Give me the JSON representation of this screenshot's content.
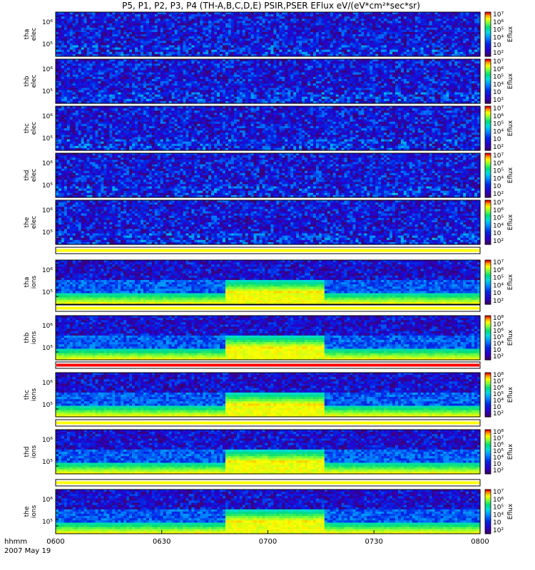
{
  "title": "P5, P1, P2, P3, P4 (TH-A,B,C,D,E) PSIR,PSER EFlux eV/(eV*cm²*sec*sr)",
  "footer": {
    "time_label": "hhmm",
    "date_label": "2007 May 19",
    "ticks": [
      "0600",
      "0630",
      "0700",
      "0730",
      "0800"
    ]
  },
  "colorbar_label": "Eflux",
  "chart_data": [
    {
      "type": "heatmap",
      "probe": "tha",
      "species": "elec",
      "ylabel_top": "tha",
      "ylabel_bottom": "elec",
      "y_scale": "log",
      "y_ticks": [
        "10⁶",
        "10⁵"
      ],
      "colorbar": [
        "10⁷",
        "10⁶",
        "10⁵",
        "10⁴",
        "10⁳",
        "10²"
      ],
      "values": "noisy background, mostly 10²–10³ throughout",
      "strip_color": ""
    },
    {
      "type": "heatmap",
      "probe": "thb",
      "species": "elec",
      "ylabel_top": "thb",
      "ylabel_bottom": "elec",
      "y_scale": "log",
      "y_ticks": [
        "10⁶",
        "10⁵"
      ],
      "colorbar": [
        "10⁷",
        "10⁶",
        "10⁵",
        "10⁴",
        "10⁳",
        "10²"
      ],
      "values": "noisy background, mostly 10²–10³ throughout",
      "strip_color": ""
    },
    {
      "type": "heatmap",
      "probe": "thc",
      "species": "elec",
      "ylabel_top": "thc",
      "ylabel_bottom": "elec",
      "y_scale": "log",
      "y_ticks": [
        "10⁶",
        "10⁵"
      ],
      "colorbar": [
        "10⁷",
        "10⁶",
        "10⁵",
        "10⁴",
        "10⁳",
        "10²"
      ],
      "values": "noisy background, mostly 10²–10³ throughout",
      "strip_color": ""
    },
    {
      "type": "heatmap",
      "probe": "thd",
      "species": "elec",
      "ylabel_top": "thd",
      "ylabel_bottom": "elec",
      "y_scale": "log",
      "y_ticks": [
        "10⁶",
        "10⁵"
      ],
      "colorbar": [
        "10⁷",
        "10⁶",
        "10⁵",
        "10⁴",
        "10⁳",
        "10²"
      ],
      "values": "noisy background, mostly 10²–10³ throughout",
      "strip_color": ""
    },
    {
      "type": "heatmap",
      "probe": "the",
      "species": "elec",
      "ylabel_top": "the",
      "ylabel_bottom": "elec",
      "y_scale": "log",
      "y_ticks": [
        "10⁶",
        "10⁵"
      ],
      "colorbar": [
        "10⁷",
        "10⁶",
        "10⁵",
        "10⁴",
        "10⁳",
        "10²"
      ],
      "values": "noisy background, mostly 10²–10³ throughout",
      "strip_color": "#ffff00"
    },
    {
      "type": "heatmap",
      "probe": "tha",
      "species": "ions",
      "ylabel_top": "tha",
      "ylabel_bottom": "ions",
      "y_scale": "log",
      "y_ticks": [
        "10⁶",
        "10⁵"
      ],
      "colorbar": [
        "10⁷",
        "10⁶",
        "10⁵",
        "10⁴",
        "10⁳",
        "10²"
      ],
      "values": "low-energy band ~10⁴ throughout; intense band ~10⁶ from 0648 to 0716",
      "strip_color": "#ffff00"
    },
    {
      "type": "heatmap",
      "probe": "thb",
      "species": "ions",
      "ylabel_top": "thb",
      "ylabel_bottom": "ions",
      "y_scale": "log",
      "y_ticks": [
        "10⁶",
        "10⁵"
      ],
      "colorbar": [
        "10⁸",
        "10⁷",
        "10⁶",
        "10⁵",
        "10⁴",
        "10⁳",
        "10²"
      ],
      "values": "low-energy band ~10³ throughout; band ~10⁵ from 0648 to 0716",
      "strip_color": "#ff0000"
    },
    {
      "type": "heatmap",
      "probe": "thc",
      "species": "ions",
      "ylabel_top": "thc",
      "ylabel_bottom": "ions",
      "y_scale": "log",
      "y_ticks": [
        "10⁶",
        "10⁵"
      ],
      "colorbar": [
        "10⁸",
        "10⁷",
        "10⁶",
        "10⁵",
        "10⁴",
        "10⁳",
        "10²"
      ],
      "values": "low-energy band ~10³–10⁴; band ~10⁵ from 0648 to 0720",
      "strip_color": "#ffff00"
    },
    {
      "type": "heatmap",
      "probe": "thd",
      "species": "ions",
      "ylabel_top": "thd",
      "ylabel_bottom": "ions",
      "y_scale": "log",
      "y_ticks": [
        "10⁶",
        "10⁵"
      ],
      "colorbar": [
        "10⁸",
        "10⁷",
        "10⁶",
        "10⁵",
        "10⁴",
        "10⁳",
        "10²"
      ],
      "values": "low-energy band ~10³–10⁴; band ~10⁵ from 0648 to 0720",
      "strip_color": "#ffff00"
    },
    {
      "type": "heatmap",
      "probe": "the",
      "species": "ions",
      "ylabel_top": "the",
      "ylabel_bottom": "ions",
      "y_scale": "log",
      "y_ticks": [
        "10⁶",
        "10⁵"
      ],
      "colorbar": [
        "10⁷",
        "10⁶",
        "10⁵",
        "10⁴",
        "10⁳",
        "10²"
      ],
      "values": "low-energy band ~10⁴ throughout; intense band ~10⁶ from 0648 to 0718",
      "strip_color": ""
    }
  ]
}
